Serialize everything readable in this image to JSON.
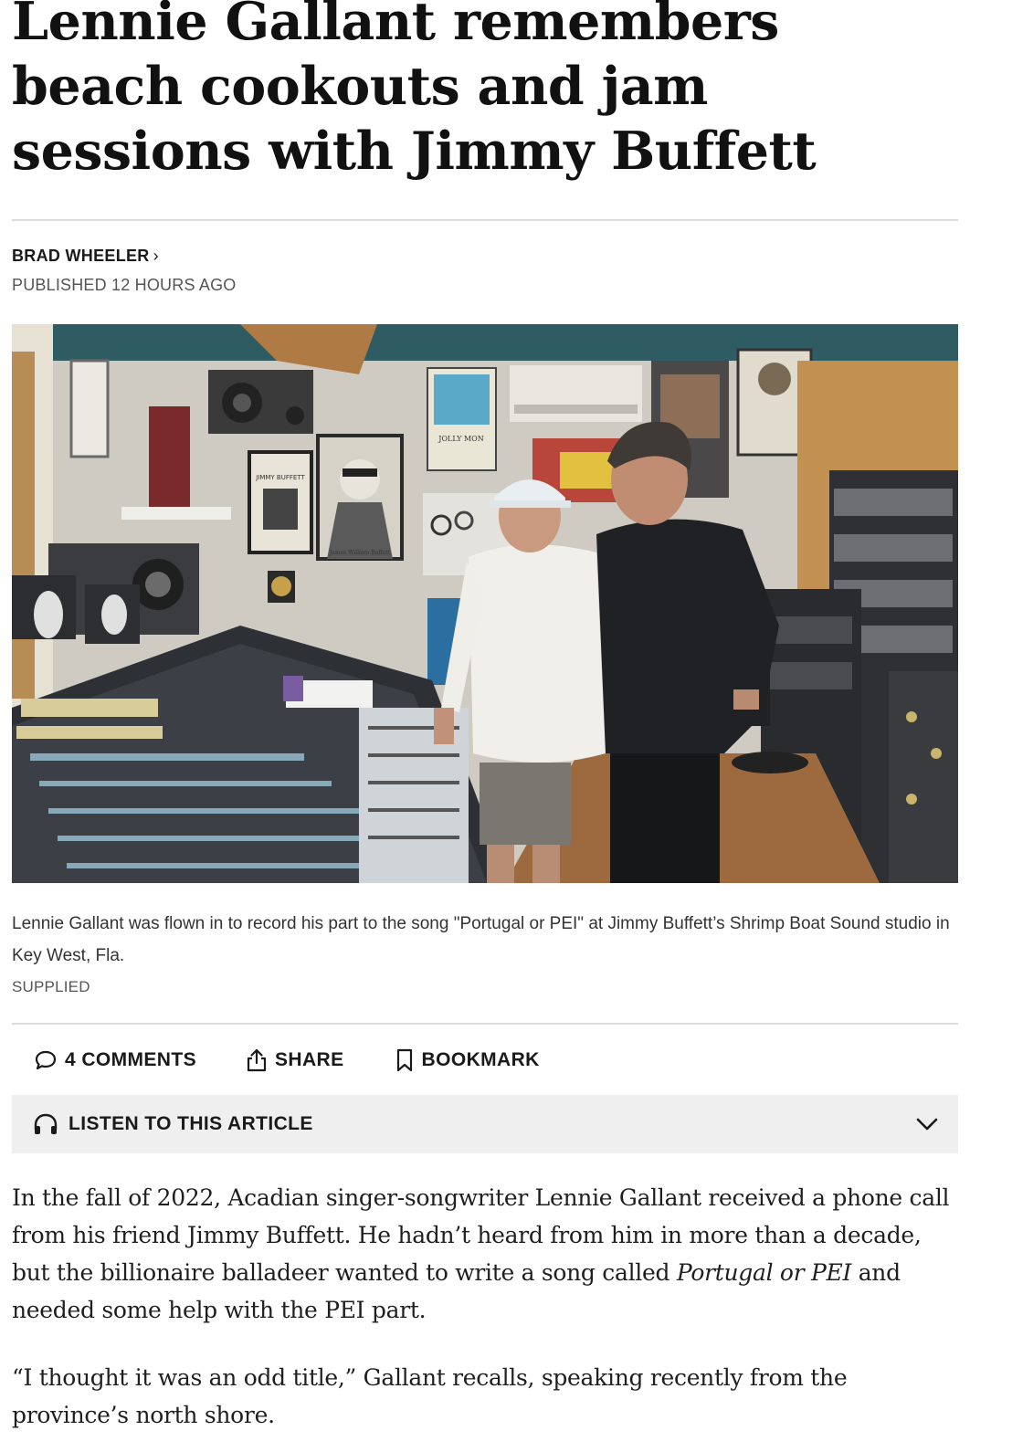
{
  "article": {
    "headline": "Lennie Gallant remembers beach cookouts and jam sessions with Jimmy Buffett",
    "author": "BRAD WHEELER",
    "published": "PUBLISHED 12 HOURS AGO",
    "photo": {
      "caption": "Lennie Gallant was flown in to record his part to the song \"Portugal or PEI\" at Jimmy Buffett’s Shrimp Boat Sound studio in Key West, Fla.",
      "credit": "SUPPLIED",
      "poster_jimmy": "JIMMY BUFFETT",
      "poster_jolly": "JOLLY MON",
      "poster_grad": "James William Buffett"
    },
    "actions": {
      "comments": "4 COMMENTS",
      "share": "SHARE",
      "bookmark": "BOOKMARK"
    },
    "listen": {
      "label": "LISTEN TO THIS ARTICLE"
    },
    "body": {
      "p1_before": "In the fall of 2022, Acadian singer-songwriter Lennie Gallant received a phone call from his friend Jimmy Buffett. He hadn’t heard from him in more than a decade, but the billionaire balladeer wanted to write a song called ",
      "p1_title": "Portugal or PEI",
      "p1_after": " and needed some help with the PEI part.",
      "p2": "“I thought it was an odd title,” Gallant recalls, speaking recently from the province’s north shore."
    }
  }
}
